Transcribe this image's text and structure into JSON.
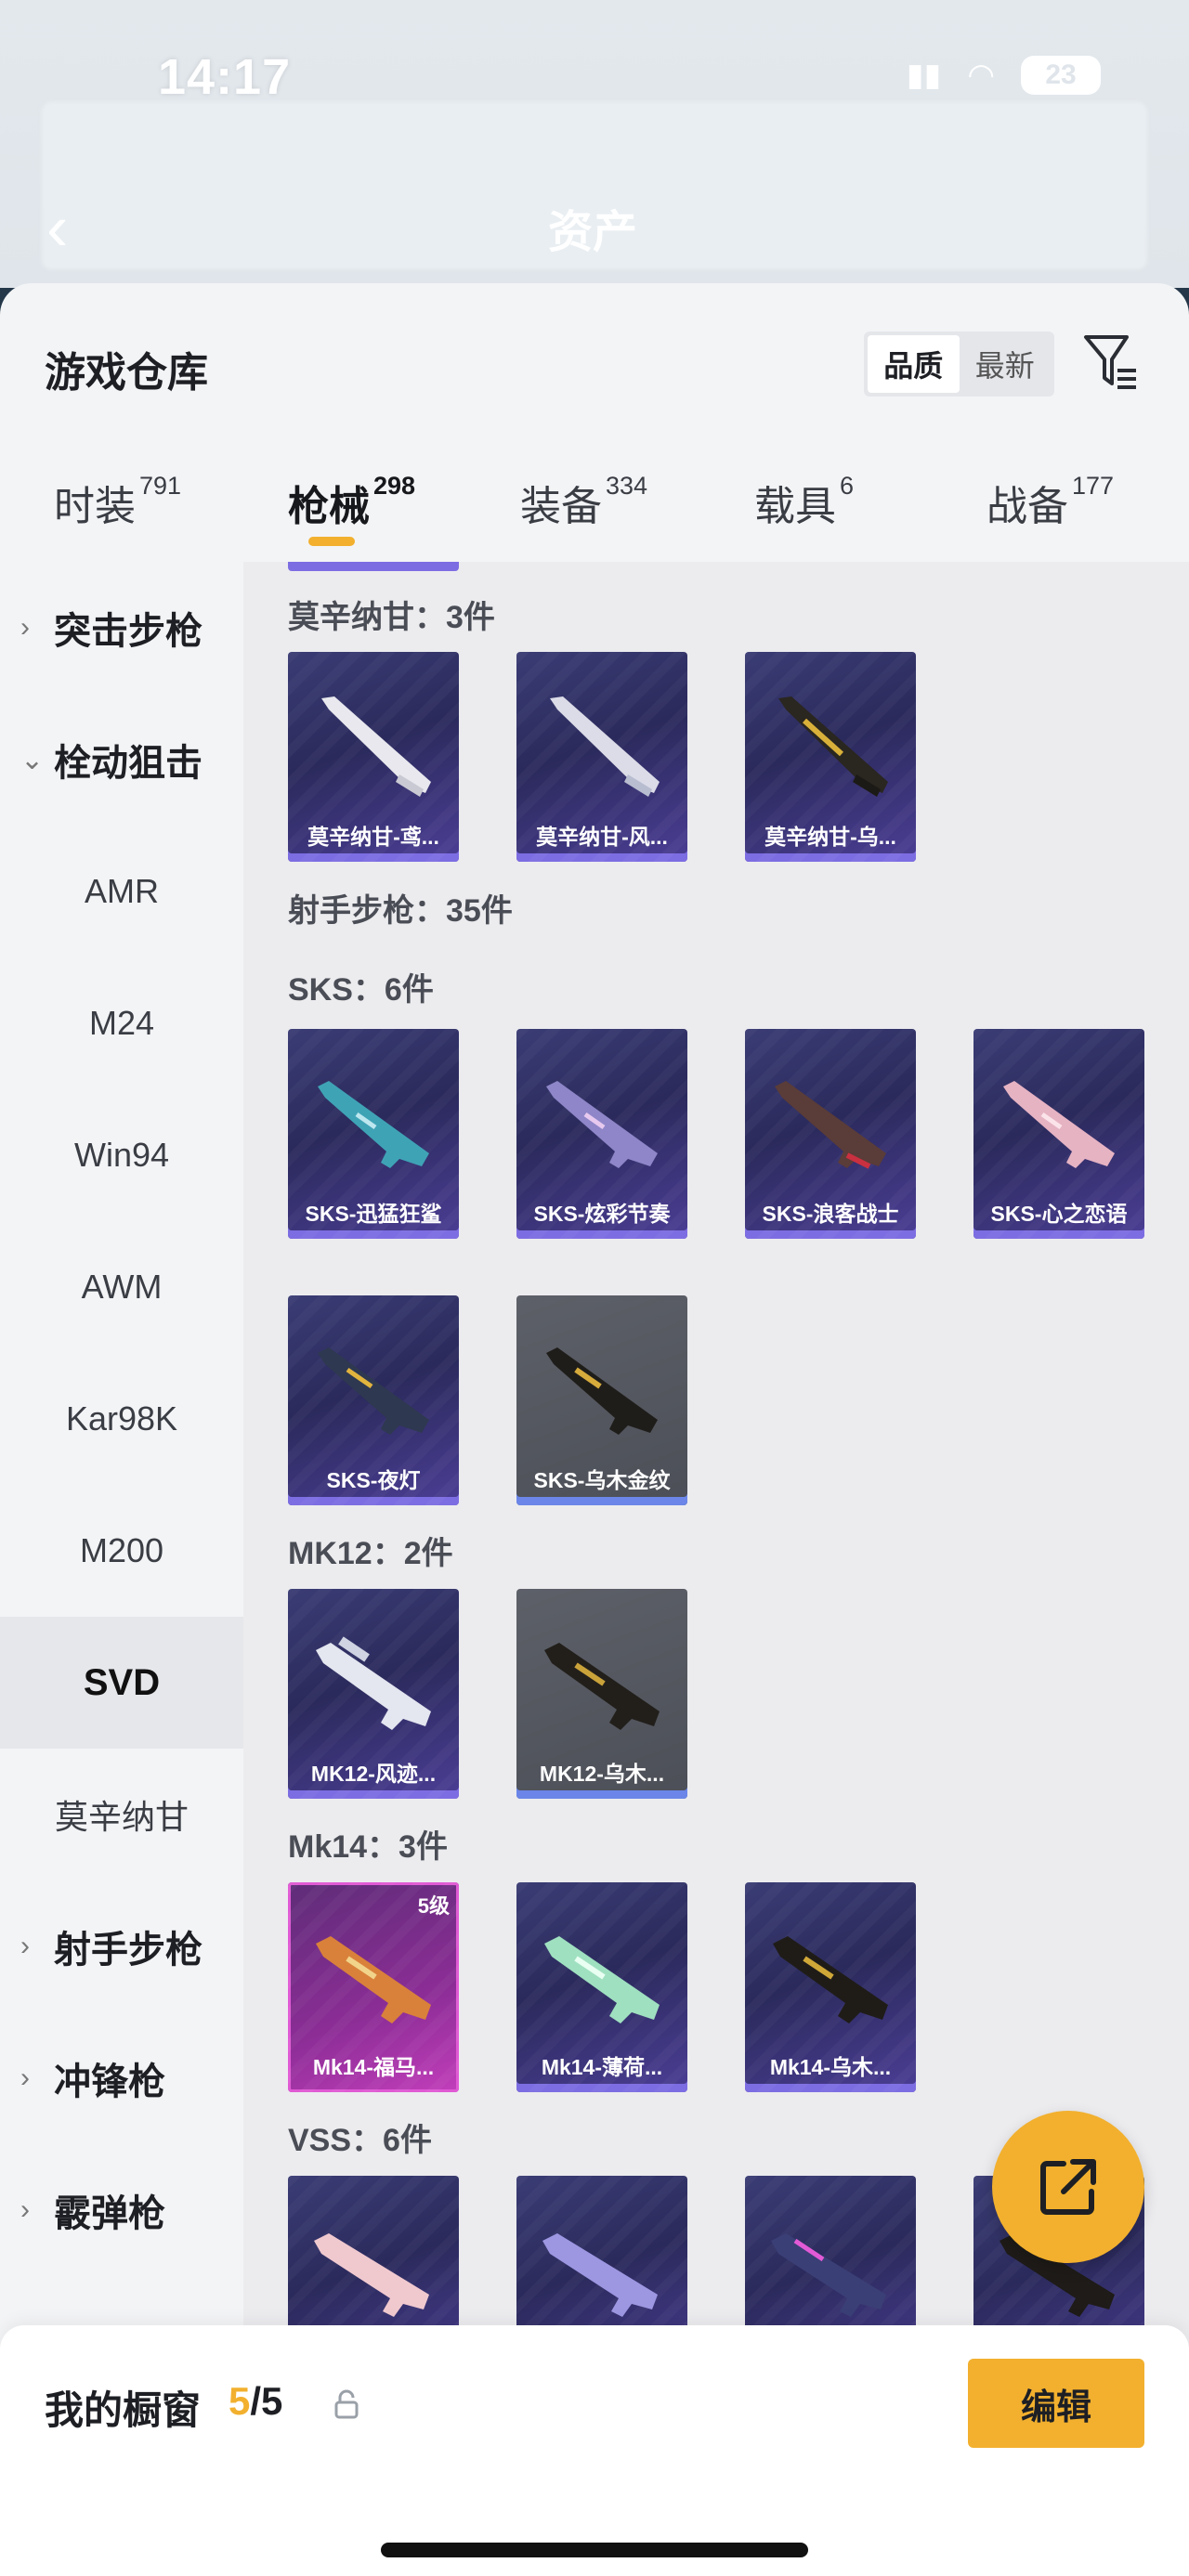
{
  "status": {
    "time": "14:17",
    "battery": "23"
  },
  "nav": {
    "title": "资产"
  },
  "sheet": {
    "title": "游戏仓库",
    "sort": {
      "quality": "品质",
      "newest": "最新"
    }
  },
  "tabs": [
    {
      "label": "时装",
      "count": "791"
    },
    {
      "label": "枪械",
      "count": "298"
    },
    {
      "label": "装备",
      "count": "334"
    },
    {
      "label": "载具",
      "count": "6"
    },
    {
      "label": "战备",
      "count": "177"
    }
  ],
  "menu": {
    "assault": "突击步枪",
    "bolt": "栓动狙击",
    "amr": "AMR",
    "m24": "M24",
    "win94": "Win94",
    "awm": "AWM",
    "kar98k": "Kar98K",
    "m200": "M200",
    "svd": "SVD",
    "mosin": "莫辛纳甘",
    "dmr": "射手步枪",
    "smg": "冲锋枪",
    "shotgun": "霰弹枪"
  },
  "sections": {
    "mosin": "莫辛纳甘：3件",
    "dmr": "射手步枪：35件",
    "sks": "SKS：6件",
    "mk12": "MK12：2件",
    "mk14": "Mk14：3件",
    "vss": "VSS：6件"
  },
  "cards": {
    "mosin": [
      "莫辛纳甘-鸢...",
      "莫辛纳甘-风...",
      "莫辛纳甘-乌..."
    ],
    "sks": [
      "SKS-迅猛狂鲨",
      "SKS-炫彩节奏",
      "SKS-浪客战士",
      "SKS-心之恋语",
      "SKS-夜灯",
      "SKS-乌木金纹"
    ],
    "mk12": [
      "MK12-风迹...",
      "MK12-乌木..."
    ],
    "mk14": [
      "Mk14-福马...",
      "Mk14-薄荷...",
      "Mk14-乌木..."
    ],
    "mk14_level": "5级"
  },
  "showcase": {
    "label": "我的橱窗",
    "current": "5",
    "total": "/5",
    "edit": "编辑"
  },
  "colors": {
    "accent": "#f2b02e",
    "card_purple": "#2b2a5c",
    "card_border": "#7d6de2"
  }
}
